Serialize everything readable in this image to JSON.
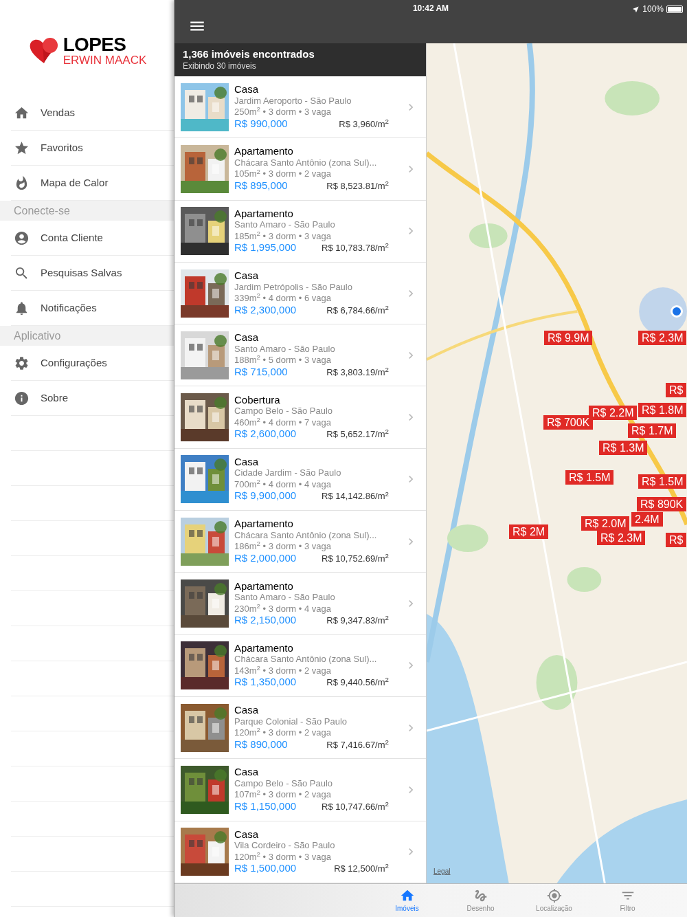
{
  "logo": {
    "name": "LOPES",
    "subtitle": "ERWIN MAACK"
  },
  "sidebar": {
    "items": [
      {
        "kind": "item",
        "label": "Vendas"
      },
      {
        "kind": "item",
        "label": "Favoritos"
      },
      {
        "kind": "item",
        "label": "Mapa de Calor"
      },
      {
        "kind": "section",
        "label": "Conecte-se"
      },
      {
        "kind": "item",
        "label": "Conta Cliente"
      },
      {
        "kind": "item",
        "label": "Pesquisas Salvas"
      },
      {
        "kind": "item",
        "label": "Notificações"
      },
      {
        "kind": "section",
        "label": "Aplicativo"
      },
      {
        "kind": "item",
        "label": "Configurações"
      },
      {
        "kind": "item",
        "label": "Sobre"
      }
    ]
  },
  "status_bar": {
    "time": "10:42 AM",
    "battery": "100%"
  },
  "results": {
    "title": "1,366 imóveis encontrados",
    "subtitle": "Exibindo 30 imóveis"
  },
  "listings": [
    {
      "type": "Casa",
      "location": "Jardim Aeroporto - São Paulo",
      "specs": "250m$^{2}$ • 3 dorm • 3 vaga",
      "price": "R$ 990,000",
      "price_per_m2": "R$ 3,960/m$^{2}$"
    },
    {
      "type": "Apartamento",
      "location": "Chácara Santo Antônio (zona Sul)...",
      "specs": "105m$^{2}$ • 3 dorm • 2 vaga",
      "price": "R$ 895,000",
      "price_per_m2": "R$ 8,523.81/m$^{2}$"
    },
    {
      "type": "Apartamento",
      "location": "Santo Amaro - São Paulo",
      "specs": "185m$^{2}$ • 3 dorm • 3 vaga",
      "price": "R$ 1,995,000",
      "price_per_m2": "R$ 10,783.78/m$^{2}$"
    },
    {
      "type": "Casa",
      "location": "Jardim Petrópolis - São Paulo",
      "specs": "339m$^{2}$ • 4 dorm • 6 vaga",
      "price": "R$ 2,300,000",
      "price_per_m2": "R$ 6,784.66/m$^{2}$"
    },
    {
      "type": "Casa",
      "location": "Santo Amaro - São Paulo",
      "specs": "188m$^{2}$ • 5 dorm • 3 vaga",
      "price": "R$ 715,000",
      "price_per_m2": "R$ 3,803.19/m$^{2}$"
    },
    {
      "type": "Cobertura",
      "location": "Campo Belo - São Paulo",
      "specs": "460m$^{2}$ • 4 dorm • 7 vaga",
      "price": "R$ 2,600,000",
      "price_per_m2": "R$ 5,652.17/m$^{2}$"
    },
    {
      "type": "Casa",
      "location": "Cidade Jardim - São Paulo",
      "specs": "700m$^{2}$ • 4 dorm • 4 vaga",
      "price": "R$ 9,900,000",
      "price_per_m2": "R$ 14,142.86/m$^{2}$"
    },
    {
      "type": "Apartamento",
      "location": "Chácara Santo Antônio (zona Sul)...",
      "specs": "186m$^{2}$ • 3 dorm • 3 vaga",
      "price": "R$ 2,000,000",
      "price_per_m2": "R$ 10,752.69/m$^{2}$"
    },
    {
      "type": "Apartamento",
      "location": "Santo Amaro - São Paulo",
      "specs": "230m$^{2}$ • 3 dorm • 4 vaga",
      "price": "R$ 2,150,000",
      "price_per_m2": "R$ 9,347.83/m$^{2}$"
    },
    {
      "type": "Apartamento",
      "location": "Chácara Santo Antônio (zona Sul)...",
      "specs": "143m$^{2}$ • 3 dorm • 2 vaga",
      "price": "R$ 1,350,000",
      "price_per_m2": "R$ 9,440.56/m$^{2}$"
    },
    {
      "type": "Casa",
      "location": "Parque Colonial - São Paulo",
      "specs": "120m$^{2}$ • 3 dorm • 2 vaga",
      "price": "R$ 890,000",
      "price_per_m2": "R$ 7,416.67/m$^{2}$"
    },
    {
      "type": "Casa",
      "location": "Campo Belo - São Paulo",
      "specs": "107m$^{2}$ • 3 dorm • 2 vaga",
      "price": "R$ 1,150,000",
      "price_per_m2": "R$ 10,747.66/m$^{2}$"
    },
    {
      "type": "Casa",
      "location": "Vila Cordeiro - São Paulo",
      "specs": "120m$^{2}$ • 3 dorm • 3 vaga",
      "price": "R$ 1,500,000",
      "price_per_m2": "R$ 12,500/m$^{2}$"
    }
  ],
  "map": {
    "markers": [
      {
        "label": "R$ 9.9M"
      },
      {
        "label": "R$ 2.3M"
      },
      {
        "label": "R$"
      },
      {
        "label": "R$ 2.2M"
      },
      {
        "label": "R$ 1.8M"
      },
      {
        "label": "R$ 700K"
      },
      {
        "label": "R$ 1.7M"
      },
      {
        "label": "R$ 1.3M"
      },
      {
        "label": "R$ 1.5M"
      },
      {
        "label": "R$ 1.5M"
      },
      {
        "label": "R$ 890K"
      },
      {
        "label": "2.4M"
      },
      {
        "label": "R$ 2.0M"
      },
      {
        "label": "R$ 2M"
      },
      {
        "label": "R$ 2.3M"
      },
      {
        "label": "R$"
      }
    ],
    "legal": "Legal"
  },
  "tabs": [
    {
      "label": "Imóveis",
      "selected": true
    },
    {
      "label": "Desenho",
      "selected": false
    },
    {
      "label": "Localização",
      "selected": false
    },
    {
      "label": "Filtro",
      "selected": false
    }
  ]
}
